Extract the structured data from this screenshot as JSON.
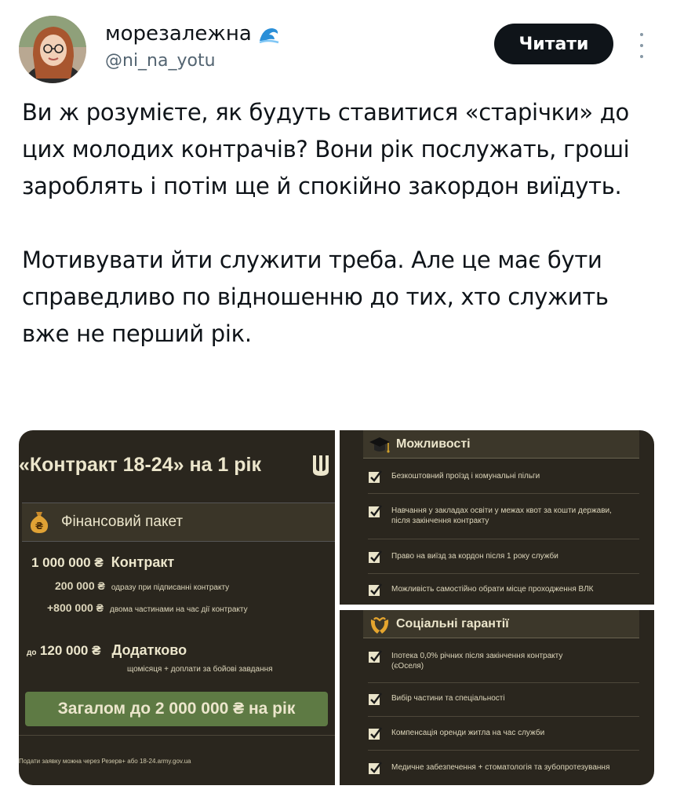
{
  "author": {
    "display_name": "морезалежна",
    "handle": "@ni_na_yotu",
    "emoji_icon": "wave-icon"
  },
  "follow_button": {
    "label": "Читати"
  },
  "tweet": {
    "paragraphs": [
      "Ви ж розумієте, як будуть ставитися «старічки» до цих молодих контрачів? Вони рік послужать, гроші зароблять і потім ще й спокійно закордон виїдуть.",
      "Мотивувати йти служити треба. Але це має бути справедливо по відношенню до тих, хто служить вже не перший рік."
    ]
  },
  "media": {
    "left": {
      "title": "«Контракт 18-24» на 1 рік",
      "financial_package": "Фінансовий пакет",
      "contract_amount": "1 000 000 ₴",
      "contract_label": "Контракт",
      "sub1_amount": "200 000 ₴",
      "sub1_label": "одразу при підписанні контракту",
      "sub2_amount": "+800 000 ₴",
      "sub2_label": "двома частинами на час дії контракту",
      "extra_prefix": "до",
      "extra_amount": "120 000 ₴",
      "extra_label": "Додатково",
      "extra_desc": "щомісяця + доплати за бойові завдання",
      "total": "Загалом до 2 000 000 ₴ на рік",
      "footnote": "Подати заявку можна через Резерв+ або 18-24.army.gov.ua"
    },
    "opportunities": {
      "title": "Можливості",
      "items": [
        "Безкоштовний проїзд і комунальні пільги",
        "Навчання у закладах освіти у межах квот за кошти держави, після закінчення контракту",
        "Право на виїзд за кордон після 1 року служби",
        "Можливість самостійно обрати місце проходження ВЛК"
      ]
    },
    "social": {
      "title": "Соціальні гарантії",
      "items": [
        "Іпотека 0,0% річних після закінчення контракту (єОселя)",
        "Вибір частини та спеціальності",
        "Компенсація оренди житла на час служби",
        "Медичне забезпечення + стоматологія та зубопротезування"
      ]
    }
  },
  "colors": {
    "panel_bg": "#2a261e",
    "accent_green": "#5e7a44",
    "text_cream": "#ece6cc",
    "button_black": "#0f1419"
  }
}
